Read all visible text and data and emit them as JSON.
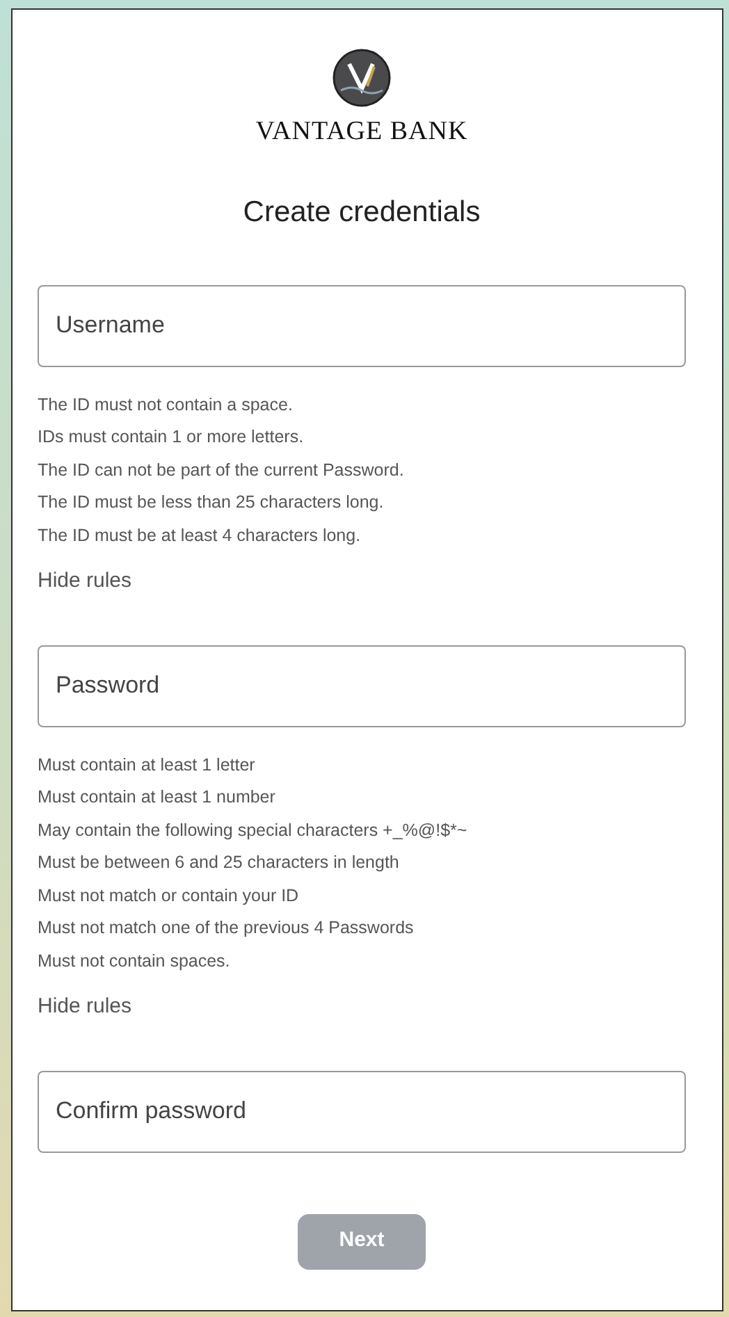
{
  "brand": {
    "name": "VANTAGE BANK"
  },
  "title": "Create credentials",
  "fields": [
    {
      "placeholder": "Username",
      "rules": [
        "The ID must not contain a space.",
        "IDs must contain 1 or more letters.",
        "The ID can not be part of the current Password.",
        "The ID must be less than 25 characters long.",
        "The ID must be at least 4 characters long."
      ],
      "toggle": "Hide rules"
    },
    {
      "placeholder": "Password",
      "rules": [
        "Must contain at least 1 letter",
        "Must contain at least 1 number",
        "May contain the following special characters +_%@!$*~",
        "Must be between 6 and 25 characters in length",
        "Must not match or contain your ID",
        "Must not match one of the previous 4 Passwords",
        "Must not contain spaces."
      ],
      "toggle": "Hide rules"
    },
    {
      "placeholder": "Confirm password"
    }
  ],
  "button": {
    "label": "Next",
    "disabled": true
  }
}
